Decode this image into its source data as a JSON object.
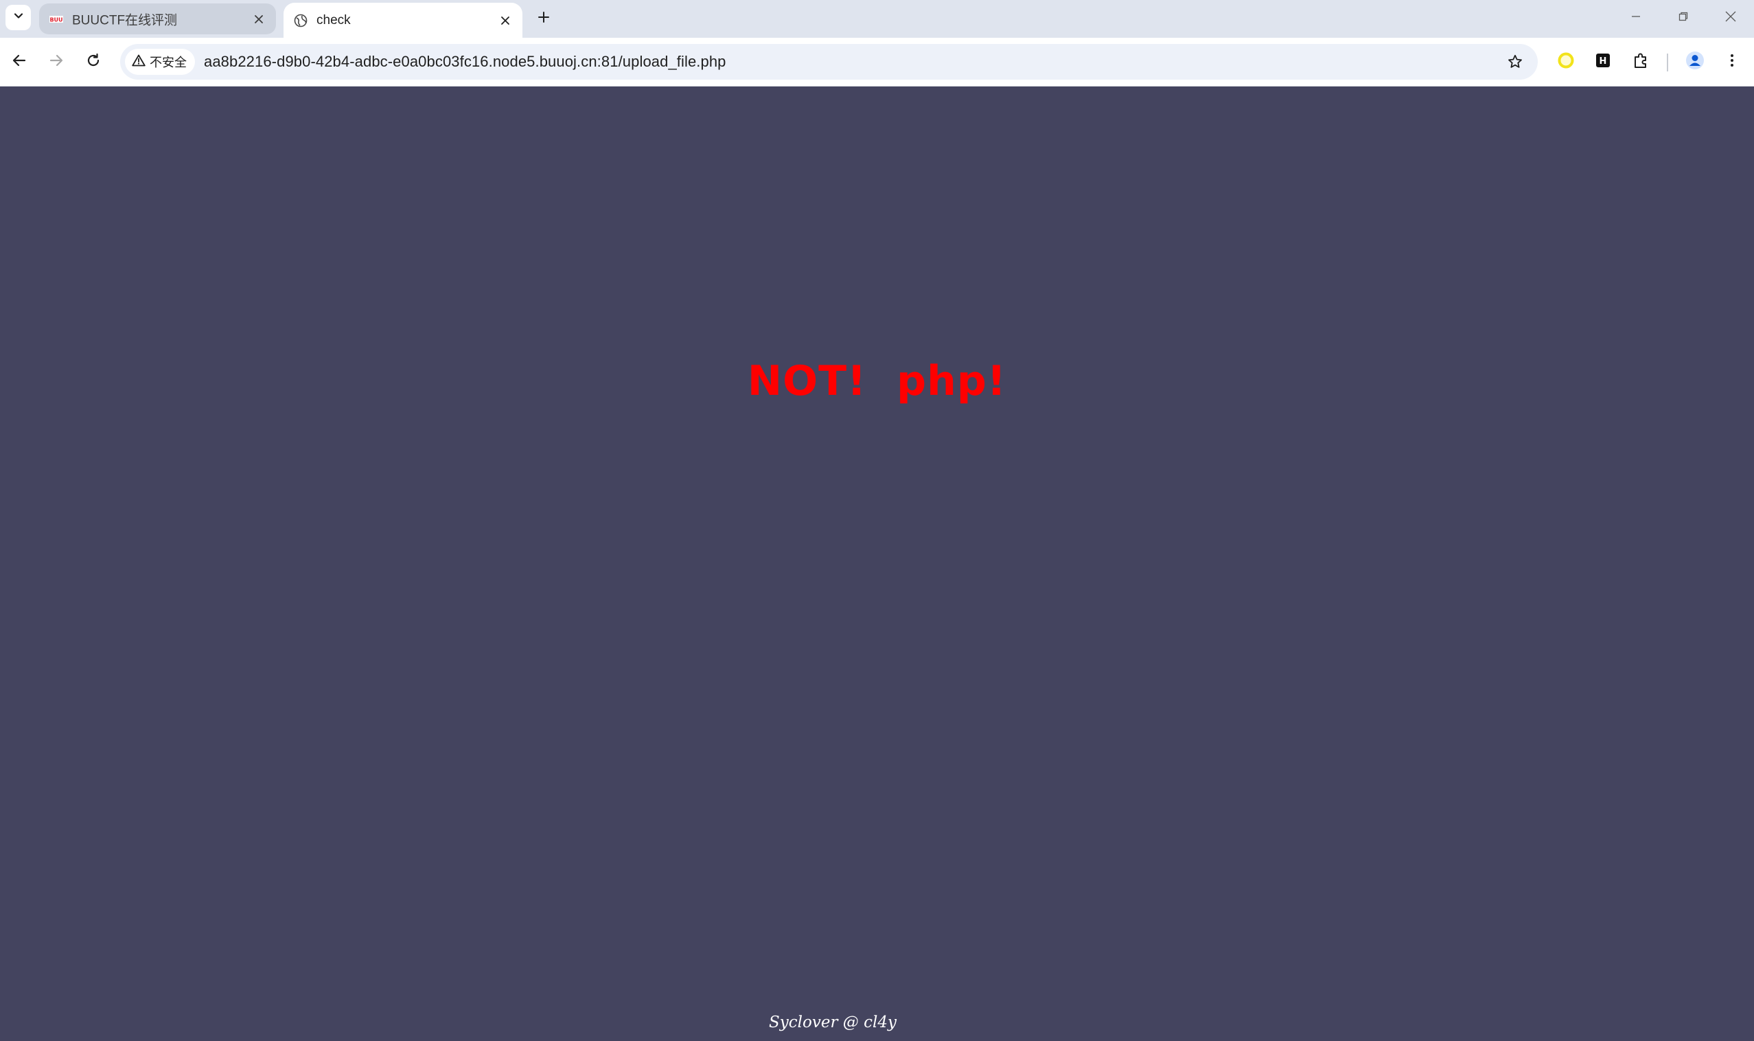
{
  "browser": {
    "tabs": [
      {
        "title": "BUUCTF在线评测",
        "favicon": "buuctf-logo-icon",
        "active": false
      },
      {
        "title": "check",
        "favicon": "globe-icon",
        "active": true
      }
    ],
    "omnibox": {
      "security_label": "不安全",
      "url": "aa8b2216-d9b0-42b4-adbc-e0a0bc03fc16.node5.buuoj.cn:81/upload_file.php"
    },
    "icons": {
      "tab_search": "chevron-down-icon",
      "tab_close": "close-icon",
      "new_tab": "plus-icon",
      "minimize": "minimize-icon",
      "restore": "restore-icon",
      "close_window": "close-icon",
      "back": "back-arrow-icon",
      "forward": "forward-arrow-icon",
      "reload": "reload-icon",
      "warning": "warning-icon",
      "bookmark": "star-icon",
      "extension_1": "yellow-circle-icon",
      "extension_2": "h-icon",
      "extensions": "puzzle-icon",
      "profile": "profile-icon",
      "menu": "kebab-menu-icon"
    },
    "colors": {
      "tabstrip_bg": "#dfe4ee",
      "page_bg": "#44445f",
      "message_color": "#ff0000",
      "footer_color": "#ffffff"
    }
  },
  "page": {
    "message": "NOT!  php!",
    "footer": "Syclover @ cl4y"
  }
}
